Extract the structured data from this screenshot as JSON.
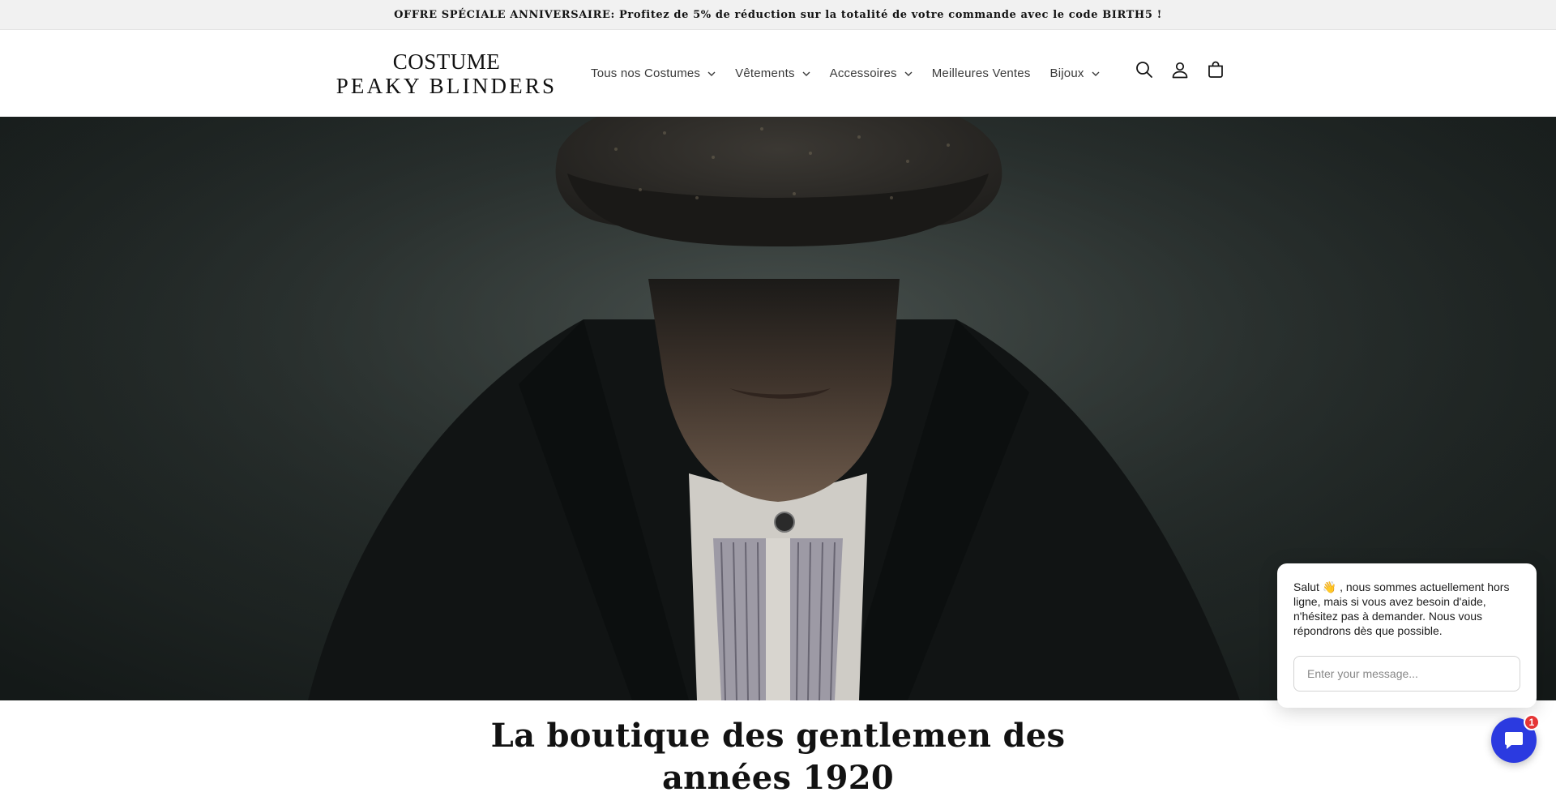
{
  "announcement": {
    "text": "OFFRE SPÉCIALE ANNIVERSAIRE: Profitez de 5% de réduction sur la totalité de votre commande avec le code BIRTH5 !"
  },
  "header": {
    "logo": {
      "line1": "COSTUME",
      "line2": "PEAKY BLINDERS"
    },
    "nav": [
      {
        "label": "Tous nos Costumes",
        "dropdown": true
      },
      {
        "label": "Vêtements",
        "dropdown": true
      },
      {
        "label": "Accessoires",
        "dropdown": true
      },
      {
        "label": "Meilleures Ventes",
        "dropdown": false
      },
      {
        "label": "Bijoux",
        "dropdown": true
      }
    ],
    "icons": [
      "search-icon",
      "account-icon",
      "cart-icon"
    ]
  },
  "hero": {
    "image": "man-in-flat-cap-portrait",
    "title": "La boutique des gentlemen des années 1920"
  },
  "chat": {
    "message": "Salut 👋 , nous sommes actuellement hors ligne, mais si vous avez besoin d'aide, n'hésitez pas à demander. Nous vous répondrons dès que possible.",
    "input_placeholder": "Enter your message...",
    "badge_count": "1",
    "launcher_color": "#2b3ae0",
    "badge_color": "#e53535"
  }
}
